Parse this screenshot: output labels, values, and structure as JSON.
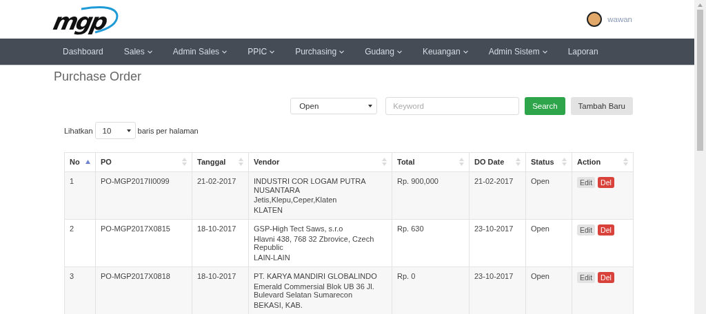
{
  "header": {
    "logo_text": "mgp",
    "user": {
      "name": "wawan"
    }
  },
  "nav": [
    {
      "label": "Dashboard",
      "dropdown": false
    },
    {
      "label": "Sales",
      "dropdown": true
    },
    {
      "label": "Admin Sales",
      "dropdown": true
    },
    {
      "label": "PPIC",
      "dropdown": true
    },
    {
      "label": "Purchasing",
      "dropdown": true
    },
    {
      "label": "Gudang",
      "dropdown": true
    },
    {
      "label": "Keuangan",
      "dropdown": true
    },
    {
      "label": "Admin Sistem",
      "dropdown": true
    },
    {
      "label": "Laporan",
      "dropdown": false
    }
  ],
  "page_title": "Purchase Order",
  "filters": {
    "status_select": {
      "value": "Open"
    },
    "keyword": {
      "placeholder": "Keyword"
    },
    "search_button": "Search",
    "add_button": "Tambah Baru"
  },
  "page_size": {
    "label_before": "Lihatkan",
    "value": "10",
    "label_after": "baris per halaman"
  },
  "table": {
    "columns": [
      {
        "label": "No",
        "sorted": true
      },
      {
        "label": "PO",
        "sorted": false
      },
      {
        "label": "Tanggal",
        "sorted": false
      },
      {
        "label": "Vendor",
        "sorted": false
      },
      {
        "label": "Total",
        "sorted": false
      },
      {
        "label": "DO Date",
        "sorted": false
      },
      {
        "label": "Status",
        "sorted": false
      },
      {
        "label": "Action",
        "sorted": false
      }
    ],
    "rows": [
      {
        "no": "1",
        "po": "PO-MGP2017II0099",
        "tanggal": "21-02-2017",
        "vendor": [
          "INDUSTRI COR LOGAM PUTRA NUSANTARA",
          "Jetis,Klepu,Ceper,Klaten",
          "KLATEN"
        ],
        "total": "Rp. 900,000",
        "do_date": "21-02-2017",
        "status": "Open",
        "actions": [
          {
            "label": "Edit",
            "kind": "edit"
          },
          {
            "label": "Del",
            "kind": "delete"
          }
        ]
      },
      {
        "no": "2",
        "po": "PO-MGP2017X0815",
        "tanggal": "18-10-2017",
        "vendor": [
          "GSP-High Tect Saws, s.r.o",
          "Hlavni 438, 768 32 Zbrovice, Czech Republic",
          "LAIN-LAIN"
        ],
        "total": "Rp. 630",
        "do_date": "23-10-2017",
        "status": "Open",
        "actions": [
          {
            "label": "Edit",
            "kind": "edit"
          },
          {
            "label": "Del",
            "kind": "delete"
          }
        ]
      },
      {
        "no": "3",
        "po": "PO-MGP2017X0818",
        "tanggal": "18-10-2017",
        "vendor": [
          "PT. KARYA MANDIRI GLOBALINDO",
          "Emerald Commersial Blok UB 36 Jl. Bulevard Selatan Sumarecon",
          "BEKASI, KAB."
        ],
        "total": "Rp. 0",
        "do_date": "23-10-2017",
        "status": "Open",
        "actions": [
          {
            "label": "Edit",
            "kind": "edit"
          },
          {
            "label": "Del",
            "kind": "delete"
          }
        ]
      }
    ]
  }
}
